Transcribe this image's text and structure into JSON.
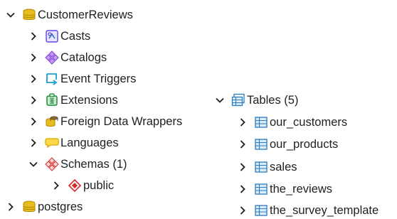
{
  "left_tree": {
    "database": {
      "label": "CustomerReviews",
      "icon": "database-icon"
    },
    "items": [
      {
        "label": "Casts",
        "icon": "casts-icon"
      },
      {
        "label": "Catalogs",
        "icon": "catalogs-icon"
      },
      {
        "label": "Event Triggers",
        "icon": "event-triggers-icon"
      },
      {
        "label": "Extensions",
        "icon": "extensions-icon"
      },
      {
        "label": "Foreign Data Wrappers",
        "icon": "foreign-data-wrappers-icon"
      },
      {
        "label": "Languages",
        "icon": "languages-icon"
      },
      {
        "label": "Schemas (1)",
        "icon": "schemas-icon"
      }
    ],
    "schema_child": {
      "label": "public",
      "icon": "schema-icon"
    },
    "other_database": {
      "label": "postgres",
      "icon": "database-icon"
    }
  },
  "right_tree": {
    "tables_group": {
      "label": "Tables (5)",
      "icon": "tables-icon"
    },
    "tables": [
      {
        "label": "our_customers",
        "icon": "table-icon"
      },
      {
        "label": "our_products",
        "icon": "table-icon"
      },
      {
        "label": "sales",
        "icon": "table-icon"
      },
      {
        "label": "the_reviews",
        "icon": "table-icon"
      },
      {
        "label": "the_survey_template",
        "icon": "table-icon"
      }
    ]
  },
  "colors": {
    "text": "#1f1f1f",
    "chevron": "#1f1f1f",
    "database_gold": "#d9a800",
    "tables_blue": "#2b7bbd",
    "schema_red": "#d42a2a"
  }
}
